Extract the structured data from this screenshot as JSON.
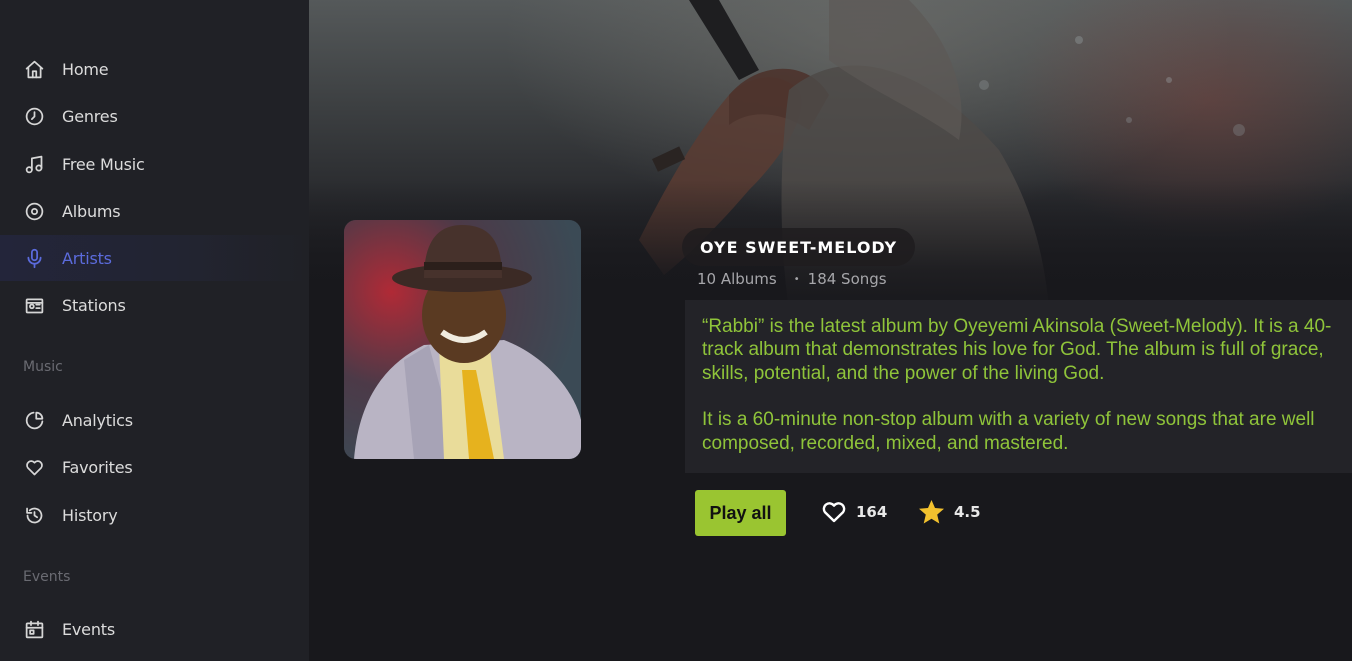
{
  "sidebar": {
    "items": [
      {
        "label": "Home",
        "icon": "home-icon"
      },
      {
        "label": "Genres",
        "icon": "genres-icon"
      },
      {
        "label": "Free Music",
        "icon": "music-note-icon"
      },
      {
        "label": "Albums",
        "icon": "disc-icon"
      },
      {
        "label": "Artists",
        "icon": "microphone-icon",
        "active": true
      },
      {
        "label": "Stations",
        "icon": "radio-icon"
      }
    ],
    "sections": {
      "music": "Music",
      "events": "Events"
    },
    "music_items": [
      {
        "label": "Analytics",
        "icon": "pie-chart-icon"
      },
      {
        "label": "Favorites",
        "icon": "heart-icon"
      },
      {
        "label": "History",
        "icon": "history-icon"
      }
    ],
    "events_items": [
      {
        "label": "Events",
        "icon": "calendar-icon"
      }
    ]
  },
  "artist": {
    "name": "OYE SWEET-MELODY",
    "albums": "10 Albums",
    "songs": "184 Songs",
    "description": [
      "“Rabbi” is the latest album by Oyeyemi Akinsola (Sweet-Melody). It is a 40-track album that demonstrates his love for God. The album is full of grace, skills, potential, and the power of the living God.",
      "It is a 60-minute non-stop album with a variety of new songs that are well composed, recorded, mixed, and mastered."
    ]
  },
  "actions": {
    "play_all": "Play all",
    "likes": "164",
    "rating": "4.5"
  },
  "colors": {
    "accent": "#9ac531",
    "active_nav": "#5b6bdc",
    "description_text": "#8fc43a",
    "star": "#f2c12e"
  }
}
